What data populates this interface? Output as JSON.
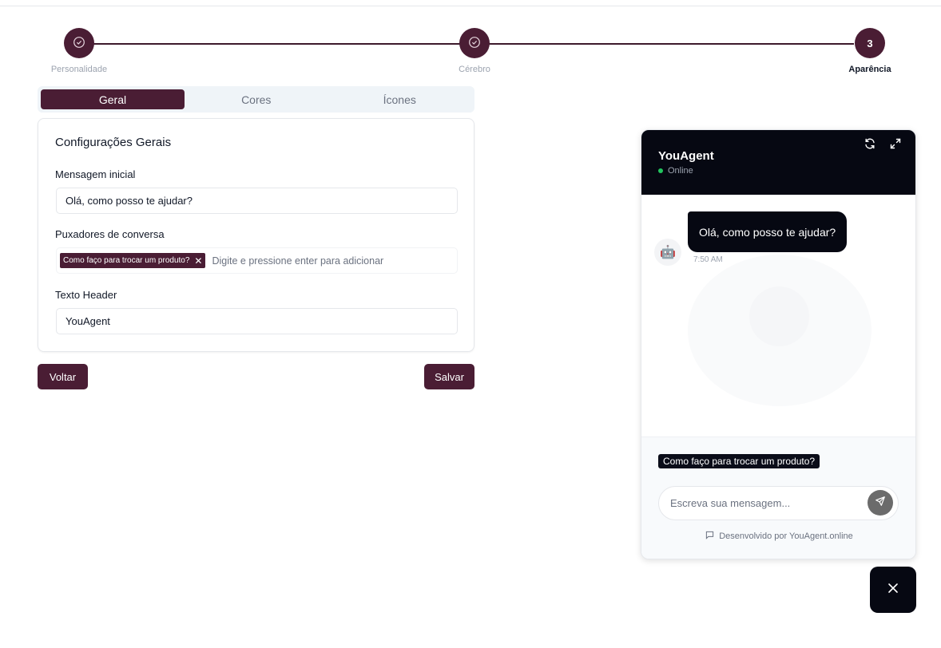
{
  "stepper": {
    "steps": [
      {
        "label": "Personalidade",
        "state": "done",
        "icon": "check-circle-icon"
      },
      {
        "label": "Cérebro",
        "state": "done",
        "icon": "check-circle-icon"
      },
      {
        "label": "Aparência",
        "state": "active",
        "number": "3"
      }
    ]
  },
  "tabs": [
    {
      "label": "Geral",
      "active": true
    },
    {
      "label": "Cores",
      "active": false
    },
    {
      "label": "Ícones",
      "active": false
    }
  ],
  "settings": {
    "title": "Configurações Gerais",
    "initial_message_label": "Mensagem inicial",
    "initial_message_value": "Olá, como posso te ajudar?",
    "starters_label": "Puxadores de conversa",
    "starters_tags": [
      "Como faço para trocar um produto?"
    ],
    "starters_placeholder": "Digite e pressione enter para adicionar",
    "header_text_label": "Texto Header",
    "header_text_value": "YouAgent"
  },
  "actions": {
    "back_label": "Voltar",
    "save_label": "Salvar"
  },
  "chat_preview": {
    "title": "YouAgent",
    "status": "Online",
    "bot_avatar": "🤖",
    "message": "Olá, como posso te ajudar?",
    "message_time": "7:50 AM",
    "suggestion": "Como faço para trocar um produto?",
    "input_placeholder": "Escreva sua mensagem...",
    "powered_by": "Desenvolvido por YouAgent.online"
  },
  "colors": {
    "primary": "#4a1d34",
    "chat_dark": "#060812",
    "status_online": "#22c55e"
  }
}
